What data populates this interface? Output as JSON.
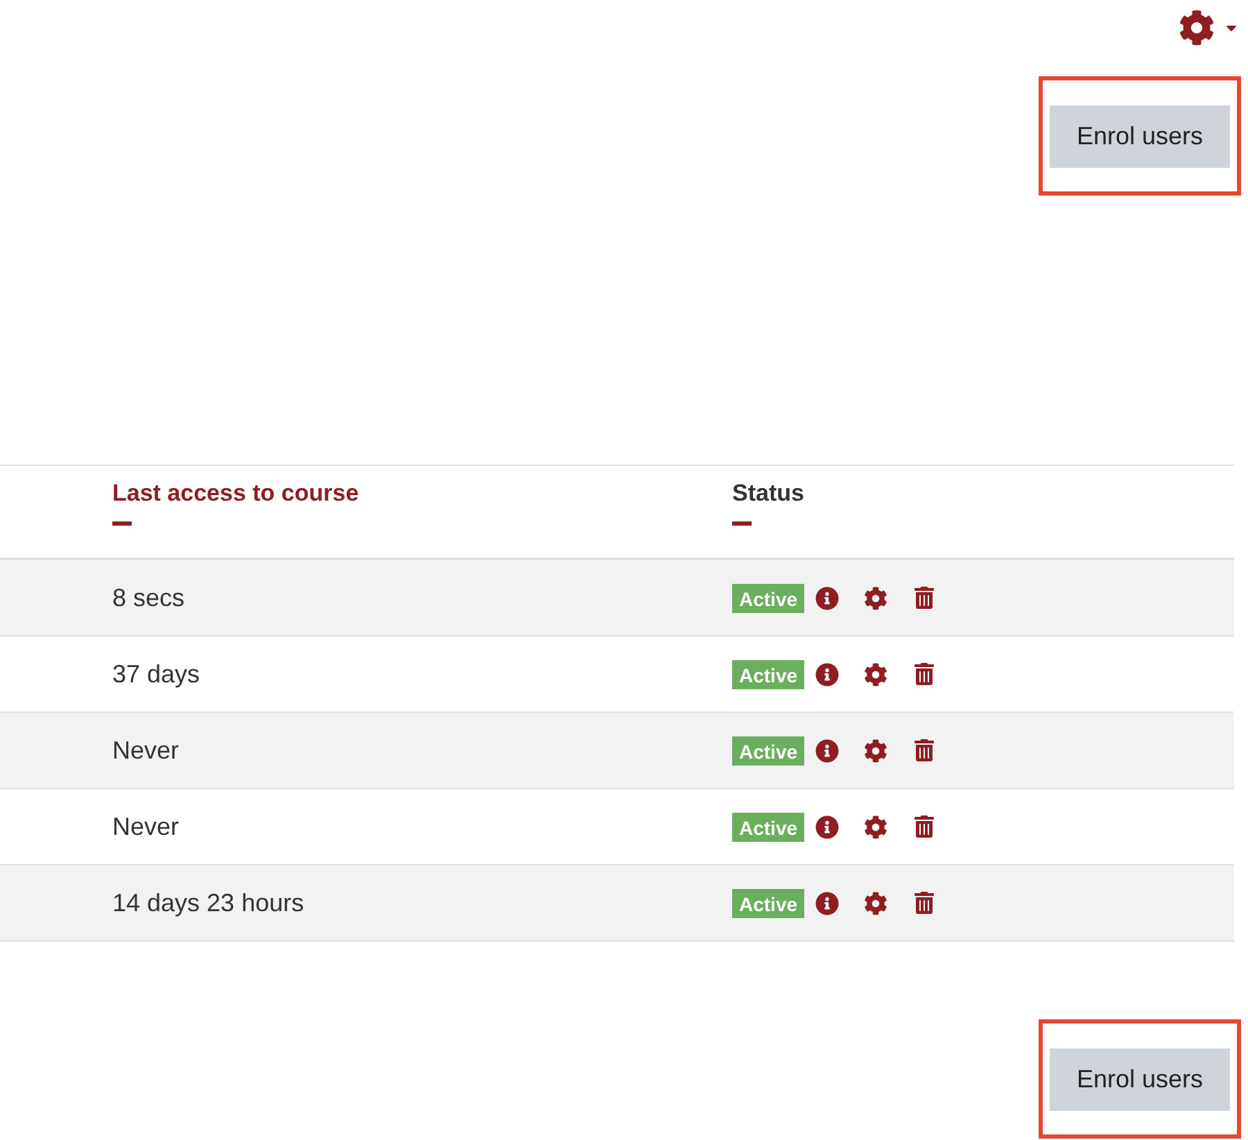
{
  "top_button": {
    "label": "Enrol users",
    "highlighted": true
  },
  "table": {
    "columns": [
      {
        "label": "Last access to course"
      },
      {
        "label": "Status"
      }
    ],
    "rows": [
      {
        "last_access": "8 secs",
        "status": "Active"
      },
      {
        "last_access": "37 days",
        "status": "Active"
      },
      {
        "last_access": "Never",
        "status": "Active"
      },
      {
        "last_access": "Never",
        "status": "Active"
      },
      {
        "last_access": "14 days 23 hours",
        "status": "Active"
      }
    ]
  },
  "bottom_button": {
    "label": "Enrol users",
    "highlighted": true
  }
}
